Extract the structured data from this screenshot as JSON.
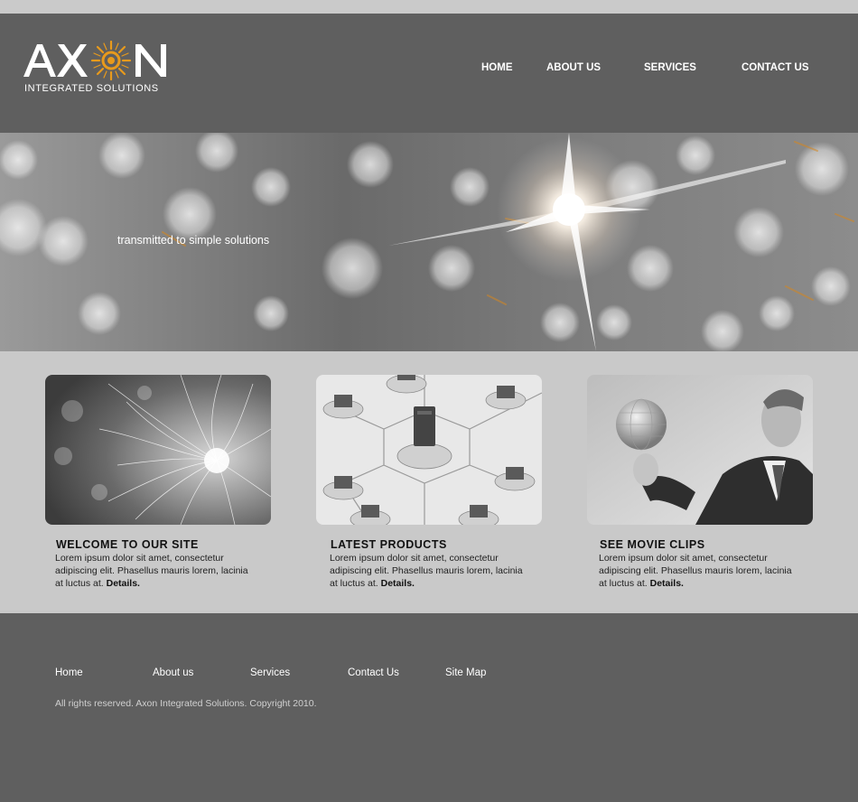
{
  "brand": {
    "name": "AXON",
    "tagline": "INTEGRATED SOLUTIONS",
    "logo_icon": "sun-burst-icon",
    "accent_color": "#e89a1c"
  },
  "nav": {
    "items": [
      {
        "label": "HOME"
      },
      {
        "label": "ABOUT US"
      },
      {
        "label": "SERVICES"
      },
      {
        "label": "CONTACT US"
      }
    ]
  },
  "hero": {
    "tagline": "transmitted to simple solutions"
  },
  "features": [
    {
      "title": "WELCOME TO OUR SITE",
      "text": "Lorem ipsum dolor sit amet, consectetur adipiscing elit. Phasellus mauris lorem, lacinia at luctus at.",
      "link": "Details.",
      "image": "fiber-optics-image"
    },
    {
      "title": "LATEST PRODUCTS",
      "text": "Lorem ipsum dolor sit amet, consectetur adipiscing elit. Phasellus mauris lorem, lacinia at luctus at.",
      "link": "Details.",
      "image": "network-computers-image"
    },
    {
      "title": "SEE MOVIE CLIPS",
      "text": "Lorem ipsum dolor sit amet, consectetur adipiscing elit. Phasellus mauris lorem, lacinia at luctus at.",
      "link": "Details.",
      "image": "businessman-globe-image"
    }
  ],
  "footer": {
    "links": [
      {
        "label": "Home"
      },
      {
        "label": "About us"
      },
      {
        "label": "Services"
      },
      {
        "label": "Contact Us"
      },
      {
        "label": "Site Map"
      }
    ],
    "copyright": "All rights reserved. Axon Integrated Solutions. Copyright 2010."
  },
  "colors": {
    "header_bg": "#5f5f5f",
    "content_bg": "#c9c9c9",
    "top_strip": "#cacaca"
  }
}
